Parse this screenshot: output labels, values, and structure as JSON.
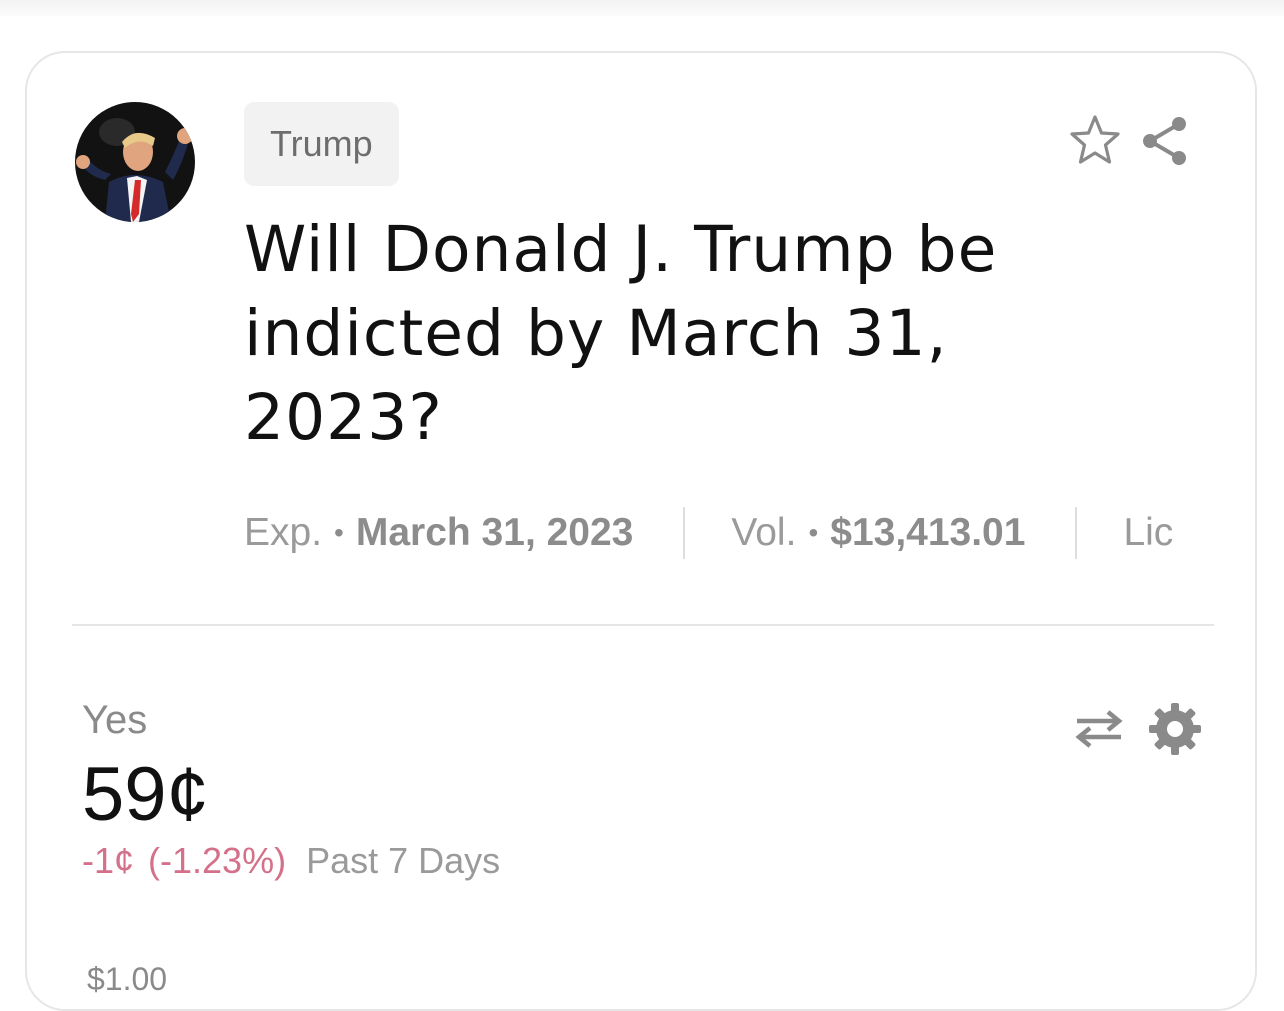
{
  "market": {
    "tag": "Trump",
    "title": "Will Donald J. Trump be indicted by March 31, 2023?",
    "meta": {
      "exp_label": "Exp.",
      "exp_value": "March 31, 2023",
      "vol_label": "Vol.",
      "vol_value": "$13,413.01",
      "liq_label": "Lic"
    },
    "outcome": "Yes",
    "price": "59¢",
    "change_abs": "-1¢",
    "change_pct": "(-1.23%)",
    "period": "Past 7 Days",
    "axis_top": "$1.00"
  },
  "icons": {
    "favorite": "star-outline-icon",
    "share": "share-icon",
    "swap": "swap-arrows-icon",
    "settings": "gear-icon"
  },
  "colors": {
    "negative": "#d4708a",
    "muted": "#8c8c8c",
    "title": "#111111",
    "icon": "#8a8a8a"
  }
}
